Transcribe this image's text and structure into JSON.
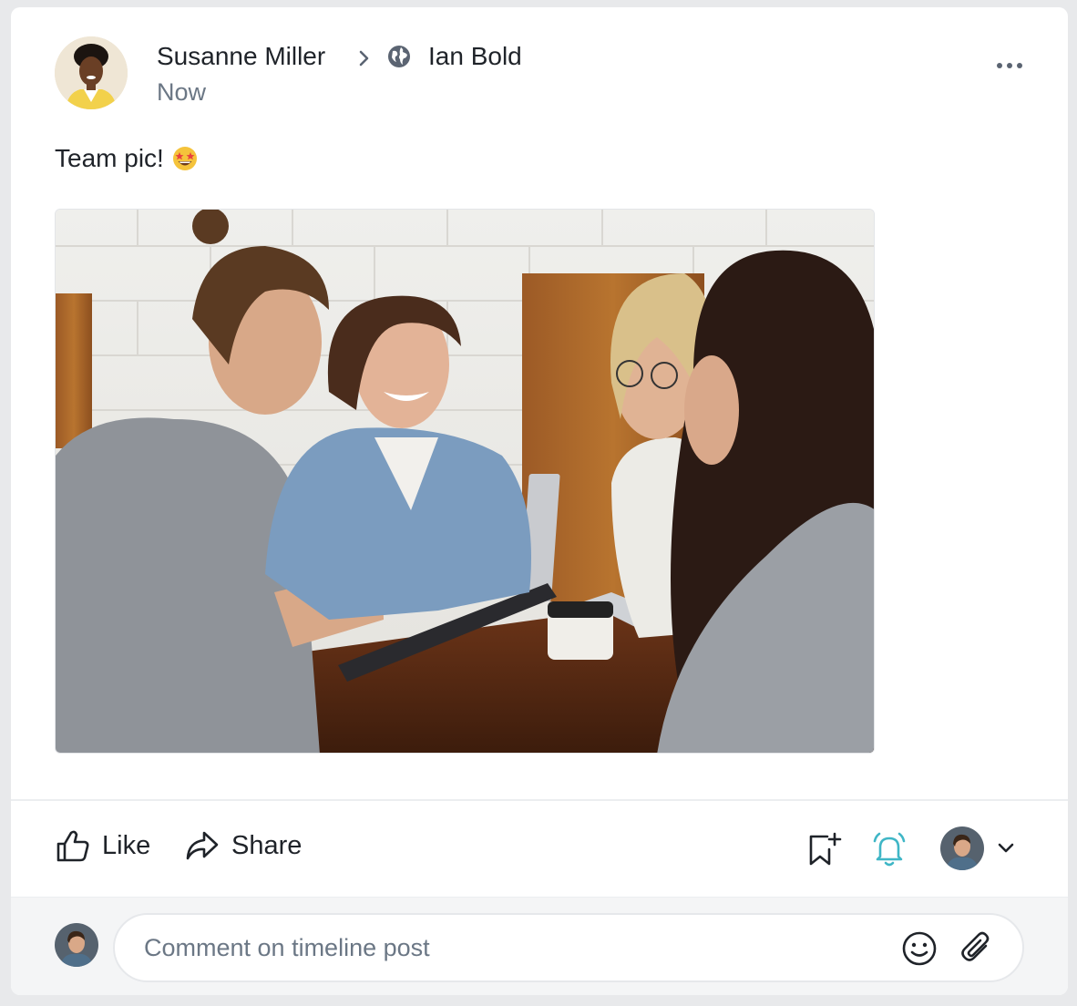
{
  "post": {
    "author": "Susanne Miller",
    "target": "Ian Bold",
    "time": "Now",
    "text": "Team pic!",
    "icons": {
      "breadcrumb": "chevron-right-icon",
      "visibility": "globe-icon",
      "menu": "more-icon",
      "emoji": "star-struck-emoji"
    }
  },
  "actions": {
    "like_label": "Like",
    "share_label": "Share",
    "icons": [
      "thumbs-up-icon",
      "share-icon",
      "bookmark-add-icon",
      "bell-icon",
      "chevron-down-icon"
    ]
  },
  "comment": {
    "placeholder": "Comment on timeline post",
    "icons": [
      "smile-icon",
      "paperclip-icon"
    ]
  },
  "colors": {
    "accent": "#3fb6c6",
    "text": "#1f2329",
    "muted": "#6b7785",
    "background": "#e8e9eb"
  }
}
